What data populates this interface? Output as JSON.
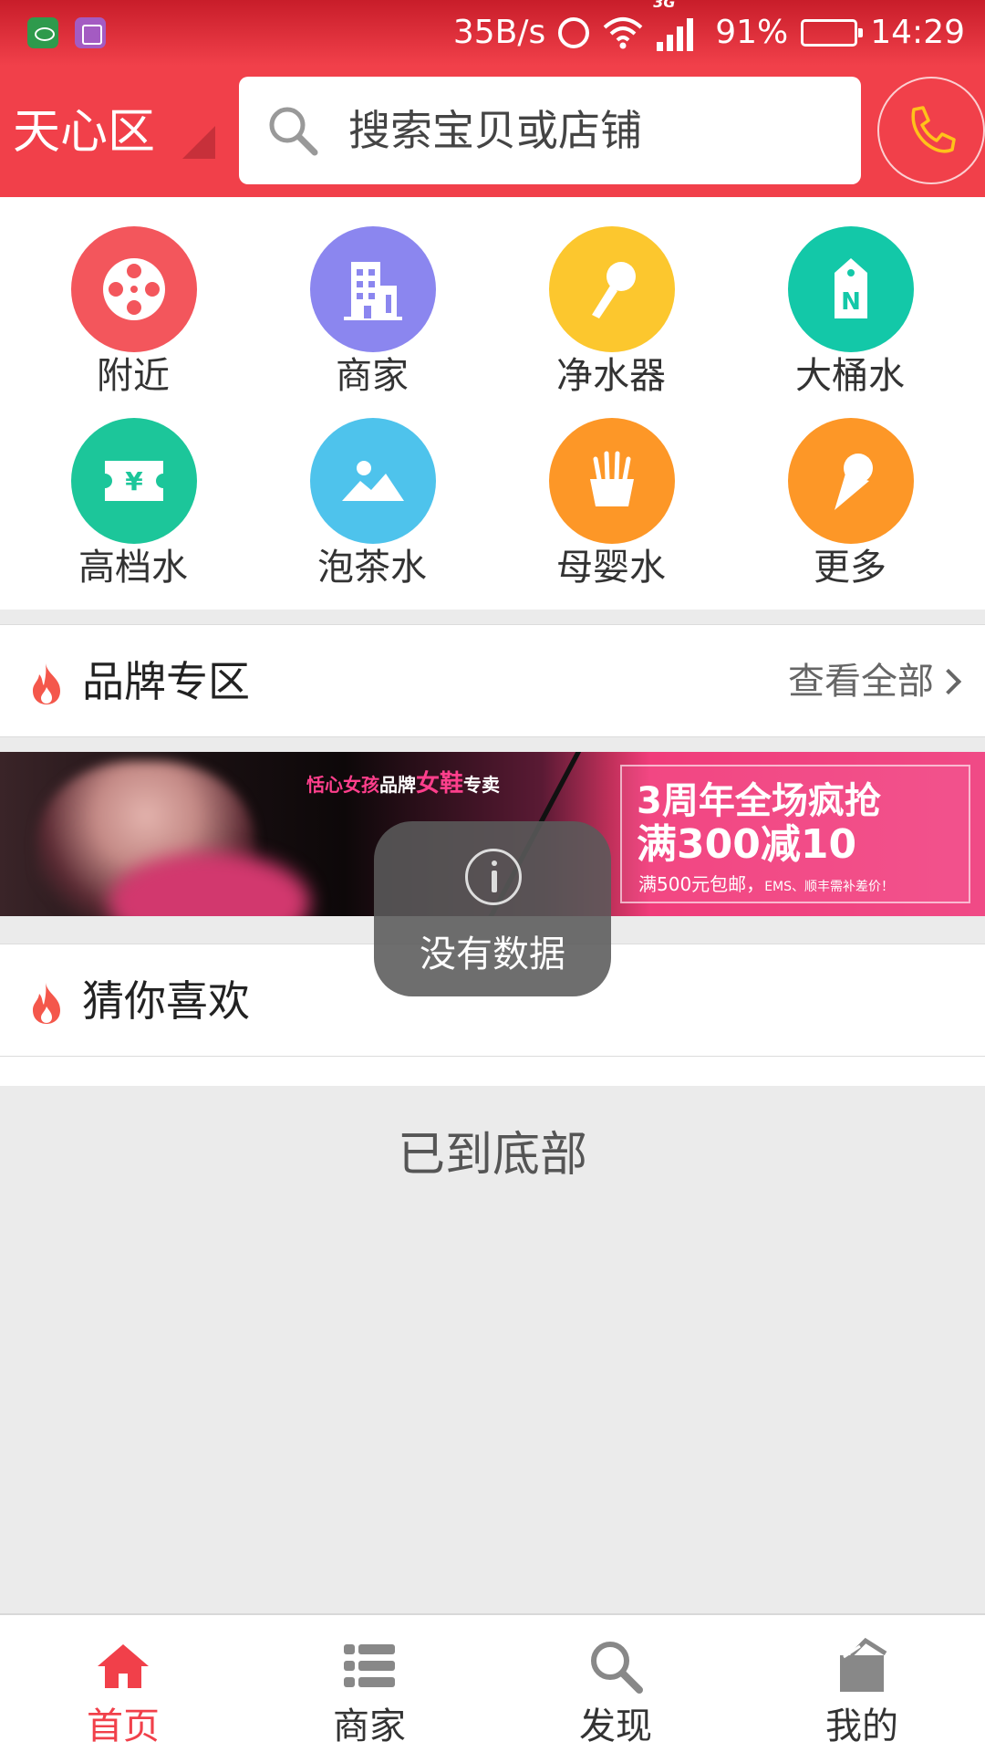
{
  "status_bar": {
    "net_speed": "35B/s",
    "network": "3G",
    "battery": "91%",
    "battery_level": 0.91,
    "time": "14:29"
  },
  "header": {
    "region": "天心区",
    "search_placeholder": "搜索宝贝或店铺"
  },
  "categories": [
    {
      "label": "附近",
      "icon": "film-reel-icon",
      "color": "#f3565c"
    },
    {
      "label": "商家",
      "icon": "building-icon",
      "color": "#8b86ef"
    },
    {
      "label": "净水器",
      "icon": "microphone-icon",
      "color": "#fcc72e"
    },
    {
      "label": "大桶水",
      "icon": "tag-icon",
      "color": "#13c8a8"
    },
    {
      "label": "高档水",
      "icon": "yen-ticket-icon",
      "color": "#1cc69a"
    },
    {
      "label": "泡茶水",
      "icon": "picture-icon",
      "color": "#4ec3ec"
    },
    {
      "label": "母婴水",
      "icon": "fries-icon",
      "color": "#fd9727"
    },
    {
      "label": "更多",
      "icon": "ice-cream-icon",
      "color": "#fd9727"
    }
  ],
  "brand_section": {
    "title": "品牌专区",
    "view_all": "查看全部"
  },
  "banner": {
    "slogan_a": "恬心女孩",
    "slogan_b": "品牌",
    "slogan_c": "女鞋",
    "slogan_d": "专卖",
    "promo_line1": "3周年全场疯抢",
    "promo_line2": "满300减10",
    "promo_line3a": "满500元包邮，",
    "promo_line3b": "EMS、顺丰需补差价！"
  },
  "toast": {
    "text": "没有数据"
  },
  "guess_section": {
    "title": "猜你喜欢"
  },
  "footer_note": "已到底部",
  "tabs": [
    {
      "label": "首页",
      "icon": "home-icon",
      "active": true
    },
    {
      "label": "商家",
      "icon": "list-icon",
      "active": false
    },
    {
      "label": "发现",
      "icon": "search-icon",
      "active": false
    },
    {
      "label": "我的",
      "icon": "bag-icon",
      "active": false
    }
  ],
  "colors": {
    "brand_red": "#f1404a",
    "tab_active": "#f1404a",
    "tab_inactive": "#888888",
    "flame": "#f4574b"
  }
}
